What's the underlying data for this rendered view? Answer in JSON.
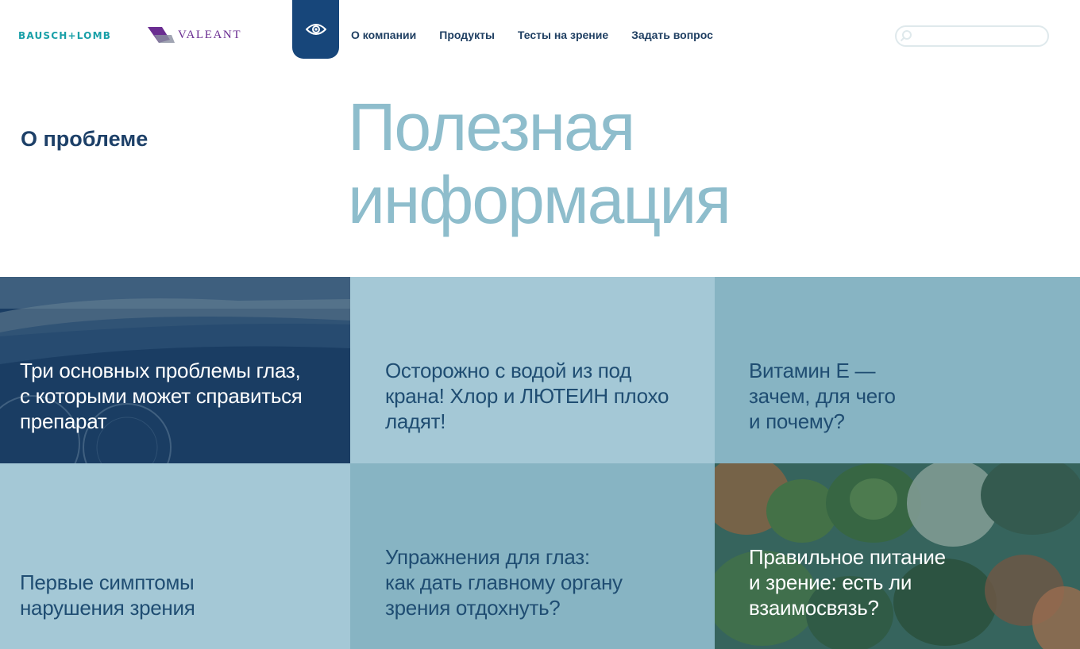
{
  "header": {
    "logo_bausch": "BAUSCH+LOMB",
    "logo_valeant": "VALEANT",
    "eye_icon": "eye-icon",
    "nav": [
      {
        "label": "О компании"
      },
      {
        "label": "Продукты"
      },
      {
        "label": "Тесты на зрение"
      },
      {
        "label": "Задать вопрос"
      }
    ],
    "search": {
      "placeholder": "",
      "value": "",
      "icon": "search-icon"
    }
  },
  "hero": {
    "side_title": "О проблеме",
    "title_line1": "Полезная",
    "title_line2": "информация"
  },
  "tiles": [
    {
      "lines": [
        "Три основных проблемы глаз,",
        "с которыми может справиться",
        "препарат"
      ]
    },
    {
      "lines": [
        "Осторожно с водой из под",
        "крана! Хлор и ЛЮТЕИН плохо",
        "ладят!"
      ]
    },
    {
      "lines": [
        "Витамин Е —",
        "зачем, для чего",
        "и почему?"
      ]
    },
    {
      "lines": [
        "Первые симптомы",
        "нарушения зрения"
      ]
    },
    {
      "lines": [
        "Упражнения для глаз:",
        "как дать главному органу",
        "зрения отдохнуть?"
      ]
    },
    {
      "lines": [
        "Правильное питание",
        "и зрение: есть ли",
        "взаимосвязь?"
      ]
    }
  ],
  "colors": {
    "brand_dark": "#17467a",
    "title_light": "#8ebdcc",
    "tile_light": "#a4c8d6",
    "tile_mid": "#87b4c3",
    "tile_dark": "#1a3d63"
  }
}
